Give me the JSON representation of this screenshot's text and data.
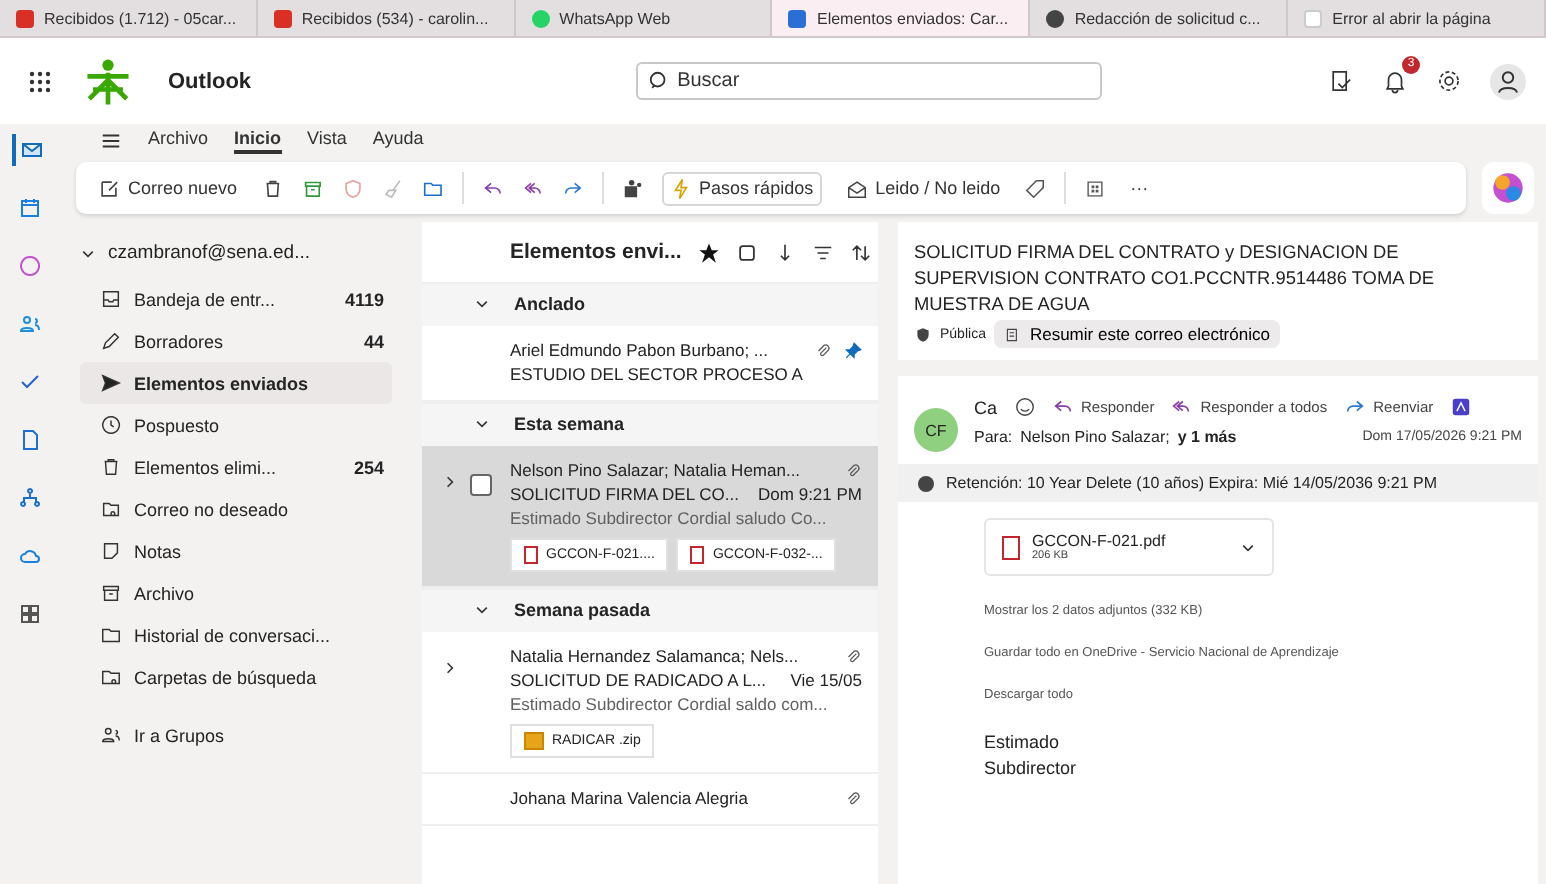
{
  "browser_tabs": [
    {
      "title": "Recibidos (1.712) - 05car...",
      "kind": "gmail",
      "selected": false
    },
    {
      "title": "Recibidos (534) - carolin...",
      "kind": "gmail",
      "selected": false
    },
    {
      "title": "WhatsApp Web",
      "kind": "whatsapp",
      "selected": false
    },
    {
      "title": "Elementos enviados: Car...",
      "kind": "outlook",
      "selected": true
    },
    {
      "title": "Redacción de solicitud c...",
      "kind": "chatgpt",
      "selected": false
    },
    {
      "title": "Error al abrir la página",
      "kind": "blank",
      "selected": false
    }
  ],
  "header": {
    "app_name": "Outlook",
    "search_placeholder": "Buscar",
    "notification_count": "3"
  },
  "menu_tabs": [
    {
      "label": "Archivo",
      "selected": false
    },
    {
      "label": "Inicio",
      "selected": true
    },
    {
      "label": "Vista",
      "selected": false
    },
    {
      "label": "Ayuda",
      "selected": false
    }
  ],
  "ribbon": {
    "new_mail": "Correo nuevo",
    "quick_steps": "Pasos rápidos",
    "read_unread": "Leido / No leido",
    "more": "···"
  },
  "app_rail": [
    {
      "kind": "mail",
      "selected": true
    },
    {
      "kind": "calendar",
      "selected": false
    },
    {
      "kind": "copilot",
      "selected": false
    },
    {
      "kind": "people",
      "selected": false
    },
    {
      "kind": "todo",
      "selected": false
    },
    {
      "kind": "files",
      "selected": false
    },
    {
      "kind": "org",
      "selected": false
    },
    {
      "kind": "cloud",
      "selected": false
    },
    {
      "kind": "apps",
      "selected": false
    }
  ],
  "folders": {
    "account": "czambranof@sena.ed...",
    "items": [
      {
        "label": "Bandeja de entr...",
        "count": "4119",
        "kind": "inbox",
        "selected": false
      },
      {
        "label": "Borradores",
        "count": "44",
        "kind": "draft",
        "selected": false
      },
      {
        "label": "Elementos enviados",
        "kind": "send",
        "selected": true
      },
      {
        "label": "Pospuesto",
        "kind": "clock",
        "selected": false
      },
      {
        "label": "Elementos elimi...",
        "count": "254",
        "kind": "trash",
        "selected": false
      },
      {
        "label": "Correo no deseado",
        "kind": "junk",
        "selected": false
      },
      {
        "label": "Notas",
        "kind": "note",
        "selected": false
      },
      {
        "label": "Archivo",
        "kind": "archive",
        "selected": false
      },
      {
        "label": "Historial de conversaci...",
        "kind": "folder",
        "selected": false
      },
      {
        "label": "Carpetas de búsqueda",
        "kind": "searchfolder",
        "selected": false
      }
    ],
    "groups_link": "Ir a Grupos"
  },
  "message_list": {
    "title": "Elementos envi...",
    "groups": [
      {
        "label": "Anclado",
        "messages": [
          {
            "sender": "Ariel Edmundo Pabon Burbano; ...",
            "subject": "ESTUDIO DEL SECTOR PROCESO A",
            "pinned": true,
            "has_attachment": true,
            "expandable": false,
            "selected": false
          }
        ]
      },
      {
        "label": "Esta semana",
        "messages": [
          {
            "sender": "Nelson Pino Salazar; Natalia Heman...",
            "subject": "SOLICITUD FIRMA DEL CO...",
            "date": "Dom 9:21 PM",
            "preview": "Estimado Subdirector Cordial saludo Co...",
            "attachments": [
              {
                "name": "GCCON-F-021....",
                "kind": "pdf"
              },
              {
                "name": "GCCON-F-032-...",
                "kind": "pdf"
              }
            ],
            "pinned": false,
            "has_attachment": true,
            "expandable": true,
            "selected": true
          }
        ]
      },
      {
        "label": "Semana pasada",
        "messages": [
          {
            "sender": "Natalia Hernandez Salamanca; Nels...",
            "subject": "SOLICITUD DE RADICADO A L...",
            "date": "Vie 15/05",
            "preview": "Estimado Subdirector Cordial saldo com...",
            "attachments": [
              {
                "name": "RADICAR .zip",
                "kind": "zip"
              }
            ],
            "pinned": false,
            "has_attachment": true,
            "expandable": true,
            "selected": false
          },
          {
            "sender": "Johana Marina Valencia Alegria",
            "pinned": false,
            "has_attachment": true,
            "expandable": false,
            "selected": false
          }
        ]
      }
    ]
  },
  "reading": {
    "subject": "SOLICITUD FIRMA DEL CONTRATO y DESIGNACION DE SUPERVISION CONTRATO CO1.PCCNTR.9514486  TOMA DE MUESTRA DE AGUA",
    "sensitivity": "Pública",
    "summarize": "Resumir este correo electrónico",
    "avatar_initials": "CF",
    "sender": "Ca",
    "actions": [
      {
        "label": "Responder",
        "kind": "reply"
      },
      {
        "label": "Responder a todos",
        "kind": "replyall"
      },
      {
        "label": "Reenviar",
        "kind": "forward"
      }
    ],
    "to_label": "Para:",
    "recipient": "Nelson Pino Salazar;",
    "more_recipients": "y 1 más",
    "date": "Dom 17/05/2026 9:21 PM",
    "retention": "Retención: 10 Year Delete (10 años) Expira: Mié 14/05/2036 9:21 PM",
    "attachment": {
      "name": "GCCON-F-021.pdf",
      "size": "206 KB"
    },
    "show_all": "Mostrar los 2 datos adjuntos (332 KB)",
    "save_onedrive": "Guardar todo en OneDrive - Servicio Nacional de Aprendizaje",
    "download_all": "Descargar todo",
    "body": [
      "Estimado",
      "Subdirector"
    ]
  }
}
